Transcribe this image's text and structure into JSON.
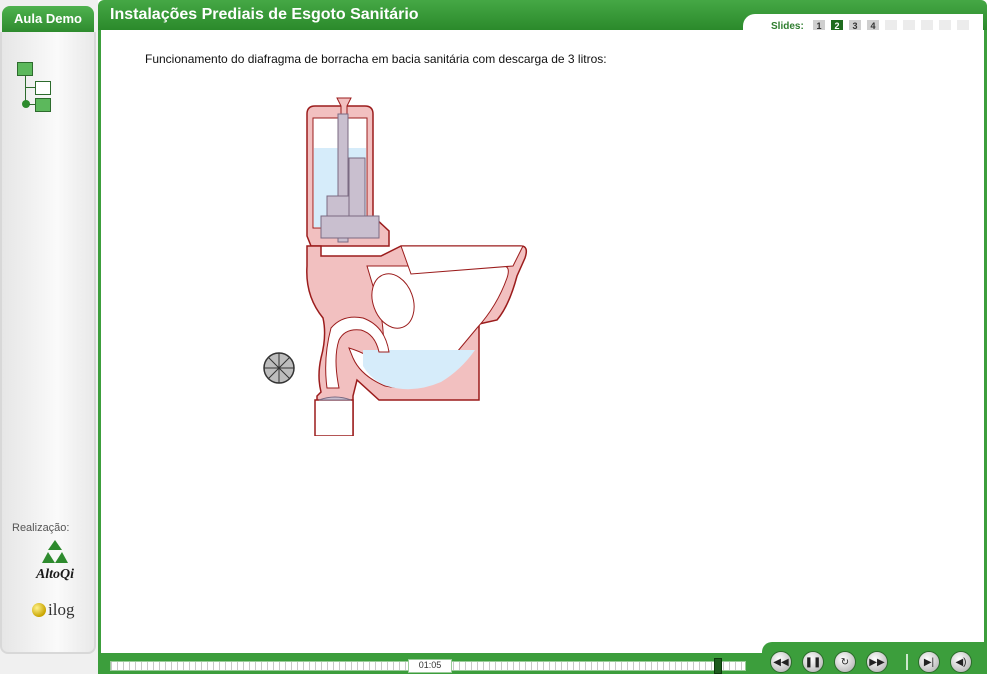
{
  "left_panel": {
    "tab_label": "Aula Demo",
    "realizacao_label": "Realização:",
    "altoqi_logo_text": "AltoQi",
    "ilog_logo_text": "ilog"
  },
  "header": {
    "title": "Instalações Prediais de Esgoto Sanitário"
  },
  "slides": {
    "label": "Slides:",
    "items": [
      {
        "label": "1",
        "active": false
      },
      {
        "label": "2",
        "active": true
      },
      {
        "label": "3",
        "active": false
      },
      {
        "label": "4",
        "active": false
      }
    ]
  },
  "content": {
    "caption": "Funcionamento do diafragma de borracha em bacia sanitária com descarga de 3 litros:"
  },
  "player": {
    "time": "01:05",
    "progress": 0.95,
    "controls": [
      "rewind-icon",
      "pause-icon",
      "replay-icon",
      "fast-forward-icon",
      "next-frame-icon",
      "volume-icon"
    ]
  },
  "colors": {
    "brand_green": "#3c9e3c",
    "title_green": "#2b8a2b",
    "toilet_fill": "#f2c0c0",
    "toilet_stroke": "#9b1c1c",
    "water": "#d6ecfa",
    "mechanism": "#c9bfcf"
  }
}
